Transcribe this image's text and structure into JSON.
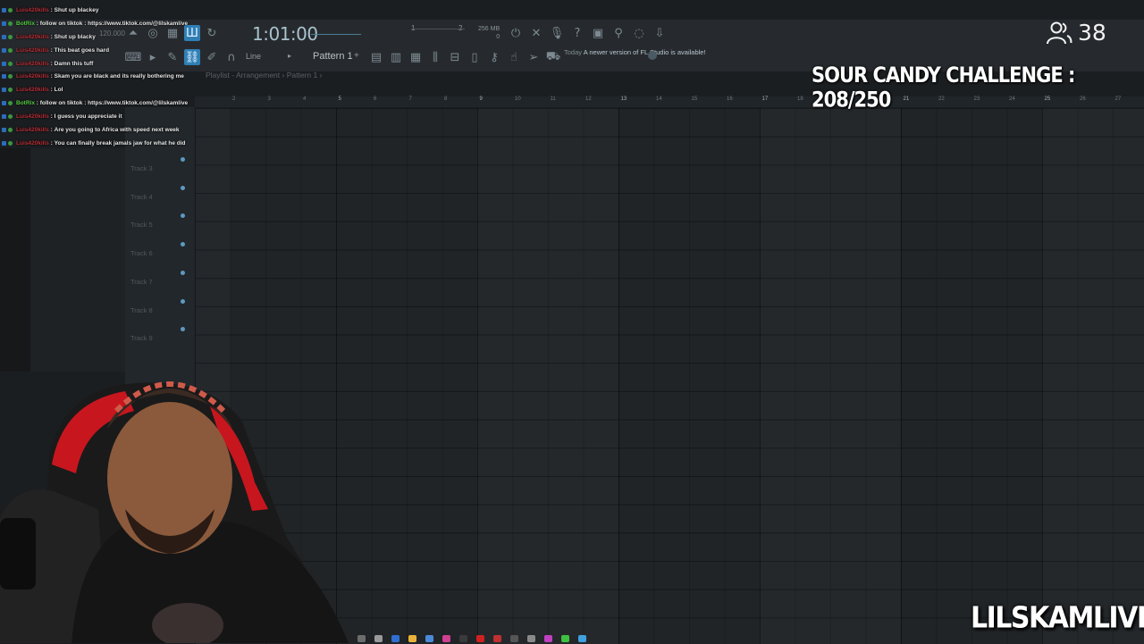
{
  "chat": [
    {
      "user": "Luis420kills",
      "bot": false,
      "message": "Shut up blackey"
    },
    {
      "user": "BotRix",
      "bot": true,
      "message": "follow on tiktok : https://www.tiktok.com/@lilskamlive"
    },
    {
      "user": "Luis420kills",
      "bot": false,
      "message": "Shut up blacky"
    },
    {
      "user": "Luis420kills",
      "bot": false,
      "message": "This beat goes hard"
    },
    {
      "user": "Luis420kills",
      "bot": false,
      "message": "Damn this tuff"
    },
    {
      "user": "Luis420kills",
      "bot": false,
      "message": "Skam you are black and its really bothering me"
    },
    {
      "user": "Luis420kills",
      "bot": false,
      "message": "Lol"
    },
    {
      "user": "BotRix",
      "bot": true,
      "message": "follow on tiktok : https://www.tiktok.com/@lilskamlive"
    },
    {
      "user": "Luis420kills",
      "bot": false,
      "message": "I guess you appreciate it"
    },
    {
      "user": "Luis420kills",
      "bot": false,
      "message": "Are you going to Africa with speed next week"
    },
    {
      "user": "Luis420kills",
      "bot": false,
      "message": "You can finally break jamals jaw for what he did"
    }
  ],
  "viewers": {
    "count": "38",
    "icon": "users-icon"
  },
  "challenge": "SOUR CANDY CHALLENGE : 208/250",
  "channel": "LILSKAMLIVE",
  "fl": {
    "tempo": "120.000",
    "time": "1:01:00",
    "cpu_left": "1",
    "cpu_right": "2",
    "memory": "256 MB",
    "memory_sub": "0",
    "pattern": "Pattern 1",
    "line_mode": "Line",
    "news_date": "Today",
    "news_text": "A newer version of FL Studio is available!",
    "playlist_title": "Playlist - Arrangement › Pattern 1 ›",
    "tracks": [
      "Track 3",
      "Track 4",
      "Track 5",
      "Track 6",
      "Track 7",
      "Track 8",
      "Track 9"
    ],
    "ruler": [
      "2",
      "3",
      "4",
      "5",
      "6",
      "7",
      "8",
      "9",
      "10",
      "11",
      "12",
      "13",
      "14",
      "15",
      "16",
      "17",
      "18",
      "19",
      "20",
      "21",
      "22",
      "23",
      "24",
      "25",
      "26",
      "27"
    ],
    "accent": "#2f7fb5"
  },
  "toolbar_icons": [
    "metronome-icon",
    "record-icon",
    "countdown-icon",
    "wait-icon",
    "loop-icon",
    "snap-icon",
    "draw-icon",
    "paint-icon",
    "pattern-prev-icon",
    "mixer-icon",
    "channel-rack-icon",
    "piano-roll-icon",
    "browser-icon",
    "plugin-icon",
    "undo-icon",
    "redo-icon",
    "save-icon",
    "help-icon",
    "settings-icon"
  ]
}
